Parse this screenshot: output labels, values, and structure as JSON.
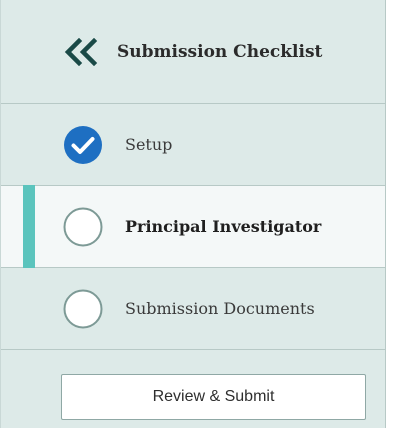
{
  "checklist": {
    "title": "Submission Checklist",
    "collapse_icon": "double-chevron-left-icon",
    "steps": [
      {
        "label": "Setup",
        "status": "complete",
        "icon": "check-circle-icon"
      },
      {
        "label": "Principal Investigator",
        "status": "current",
        "icon": "empty-circle-icon"
      },
      {
        "label": "Submission Documents",
        "status": "incomplete",
        "icon": "empty-circle-icon"
      }
    ],
    "review_button_label": "Review & Submit"
  },
  "colors": {
    "panel_background": "#ddeae8",
    "active_row_background": "#f4f8f8",
    "active_indicator": "#5bc4bd",
    "complete_check": "#1e6fc2",
    "chevron": "#1a4a47"
  }
}
